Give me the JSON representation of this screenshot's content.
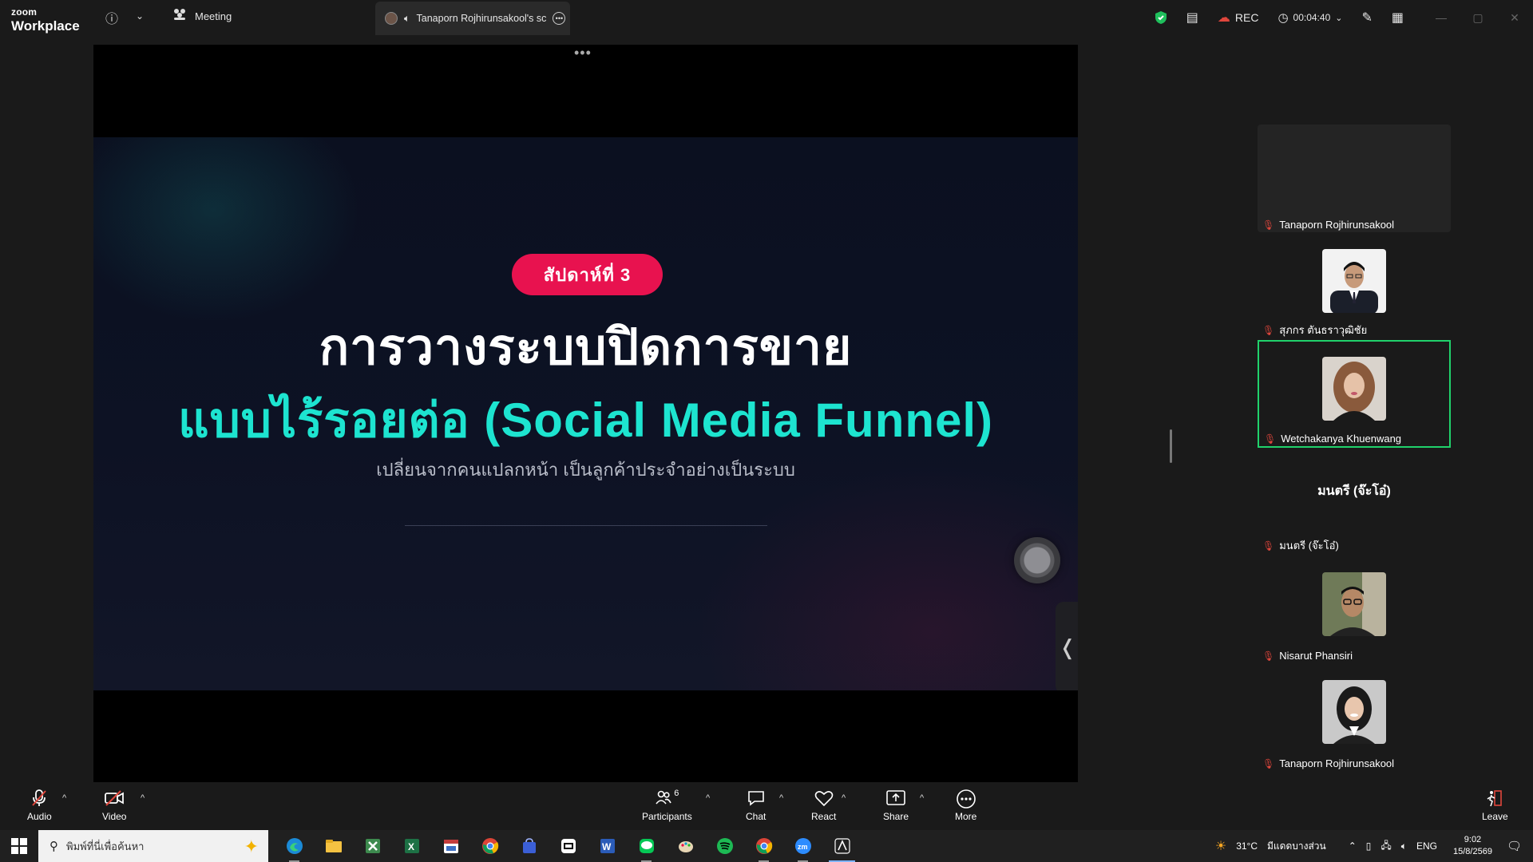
{
  "app": {
    "brand_small": "zoom",
    "brand_big": "Workplace"
  },
  "topbar": {
    "meeting_label": "Meeting",
    "share_tab_label": "Tanaporn Rojhirunsakool's sc",
    "rec_label": "REC",
    "timer": "00:04:40"
  },
  "slide": {
    "badge": "สัปดาห์ที่ 3",
    "title_line1": "การวางระบบปิดการขาย",
    "title_line2": "แบบไร้รอยต่อ (Social Media Funnel)",
    "subtitle": "เปลี่ยนจากคนแปลกหน้า เป็นลูกค้าประจำอย่างเป็นระบบ"
  },
  "participants": [
    {
      "name": "Tanaporn Rojhirunsakool",
      "photo": "none"
    },
    {
      "name": "สุภกร ตันธราวุฒิชัย",
      "photo": "man-suit"
    },
    {
      "name": "Wetchakanya Khuenwang",
      "photo": "woman",
      "active": true
    },
    {
      "name": "มนตรี (จ๊ะโอ๋)",
      "photo": "none",
      "display_name": "มนตรี (จ๊ะโอ๋)"
    },
    {
      "name": "Nisarut Phansiri",
      "photo": "man-glasses"
    },
    {
      "name": "Tanaporn Rojhirunsakool",
      "photo": "woman2"
    }
  ],
  "controls": {
    "audio": "Audio",
    "video": "Video",
    "participants": "Participants",
    "participants_count": "6",
    "chat": "Chat",
    "react": "React",
    "share": "Share",
    "more": "More",
    "leave": "Leave"
  },
  "taskbar": {
    "search_placeholder": "พิมพ์ที่นี่เพื่อค้นหา",
    "weather_temp": "31°C",
    "weather_desc": "มีแดดบางส่วน",
    "lang": "ENG",
    "time": "9:02",
    "date": "15/8/2569"
  },
  "colors": {
    "accent_green": "#20d26b",
    "badge_red": "#e8124f",
    "title_cyan": "#1de4d0",
    "mic_off_red": "#e0463c"
  }
}
